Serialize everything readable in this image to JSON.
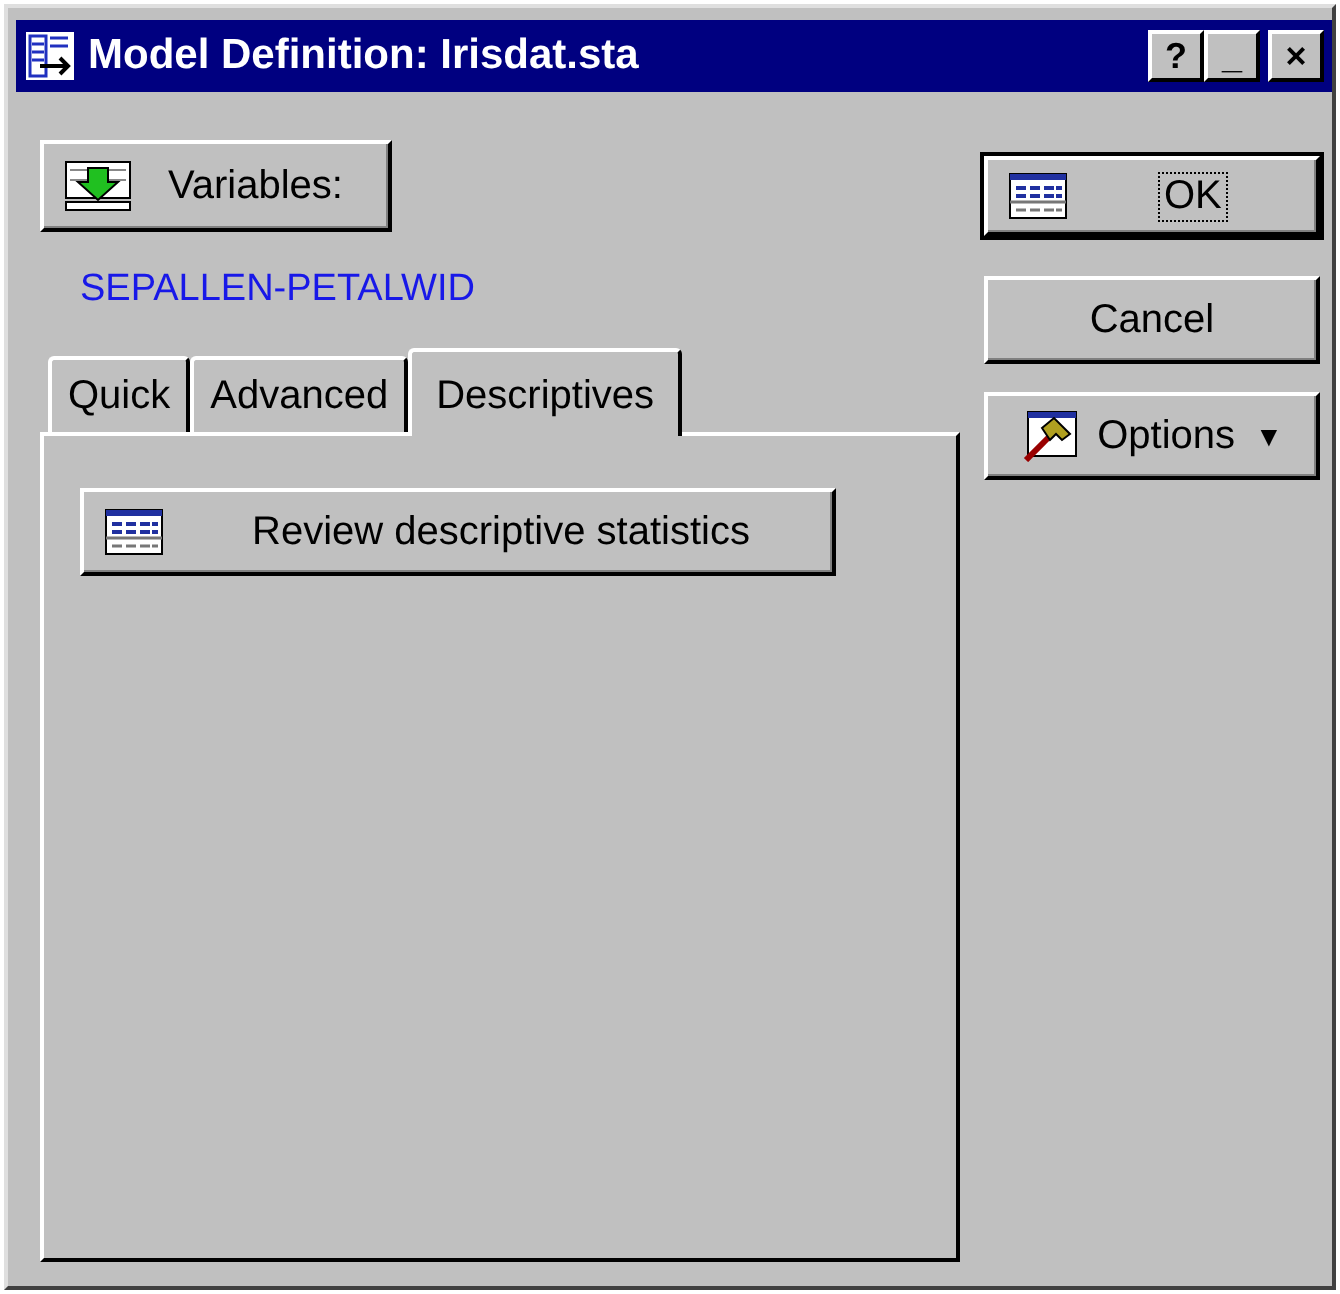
{
  "window": {
    "title": "Model Definition: Irisdat.sta",
    "title_buttons": [
      "?",
      "_",
      "×"
    ]
  },
  "variables_button": {
    "label": "Variables:"
  },
  "variables_selection": "SEPALLEN-PETALWID",
  "tabs": [
    {
      "label": "Quick",
      "selected": false
    },
    {
      "label": "Advanced",
      "selected": false
    },
    {
      "label": "Descriptives",
      "selected": true
    }
  ],
  "panel_buttons": [
    {
      "label": "Review descriptive statistics"
    }
  ],
  "side_buttons": [
    {
      "kind": "default",
      "label": "OK"
    },
    {
      "kind": "plain",
      "label": "Cancel"
    },
    {
      "kind": "menu",
      "label": "Options",
      "caret": "▼"
    }
  ]
}
